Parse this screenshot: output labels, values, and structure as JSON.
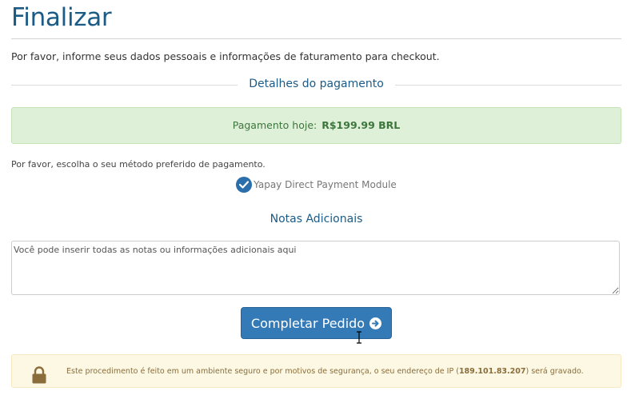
{
  "page": {
    "title": "Finalizar",
    "intro": "Por favor, informe seus dados pessoais e informações de faturamento para checkout."
  },
  "payment": {
    "section_title": "Detalhes do pagamento",
    "today_label": "Pagamento hoje:",
    "today_amount": "R$199.99 BRL",
    "method_hint": "Por favor, escolha o seu método preferido de pagamento.",
    "method_option": "Yapay Direct Payment Module",
    "method_selected": true
  },
  "notes": {
    "title": "Notas Adicionais",
    "placeholder": "Você pode inserir todas as notas ou informações adicionais aqui"
  },
  "submit": {
    "label": "Completar Pedido"
  },
  "security": {
    "text_before": "Este procedimento é feito em um ambiente seguro e por motivos de segurança, o seu endereço de IP (",
    "ip": "189.101.83.207",
    "text_after": ") será gravado."
  },
  "colors": {
    "accent": "#1b5b86",
    "button": "#337ab7",
    "success_bg": "#dff0d8",
    "warning_bg": "#fcf8e3"
  },
  "icons": [
    "check-circle-icon",
    "arrow-circle-right-icon",
    "lock-icon",
    "text-cursor-icon"
  ]
}
